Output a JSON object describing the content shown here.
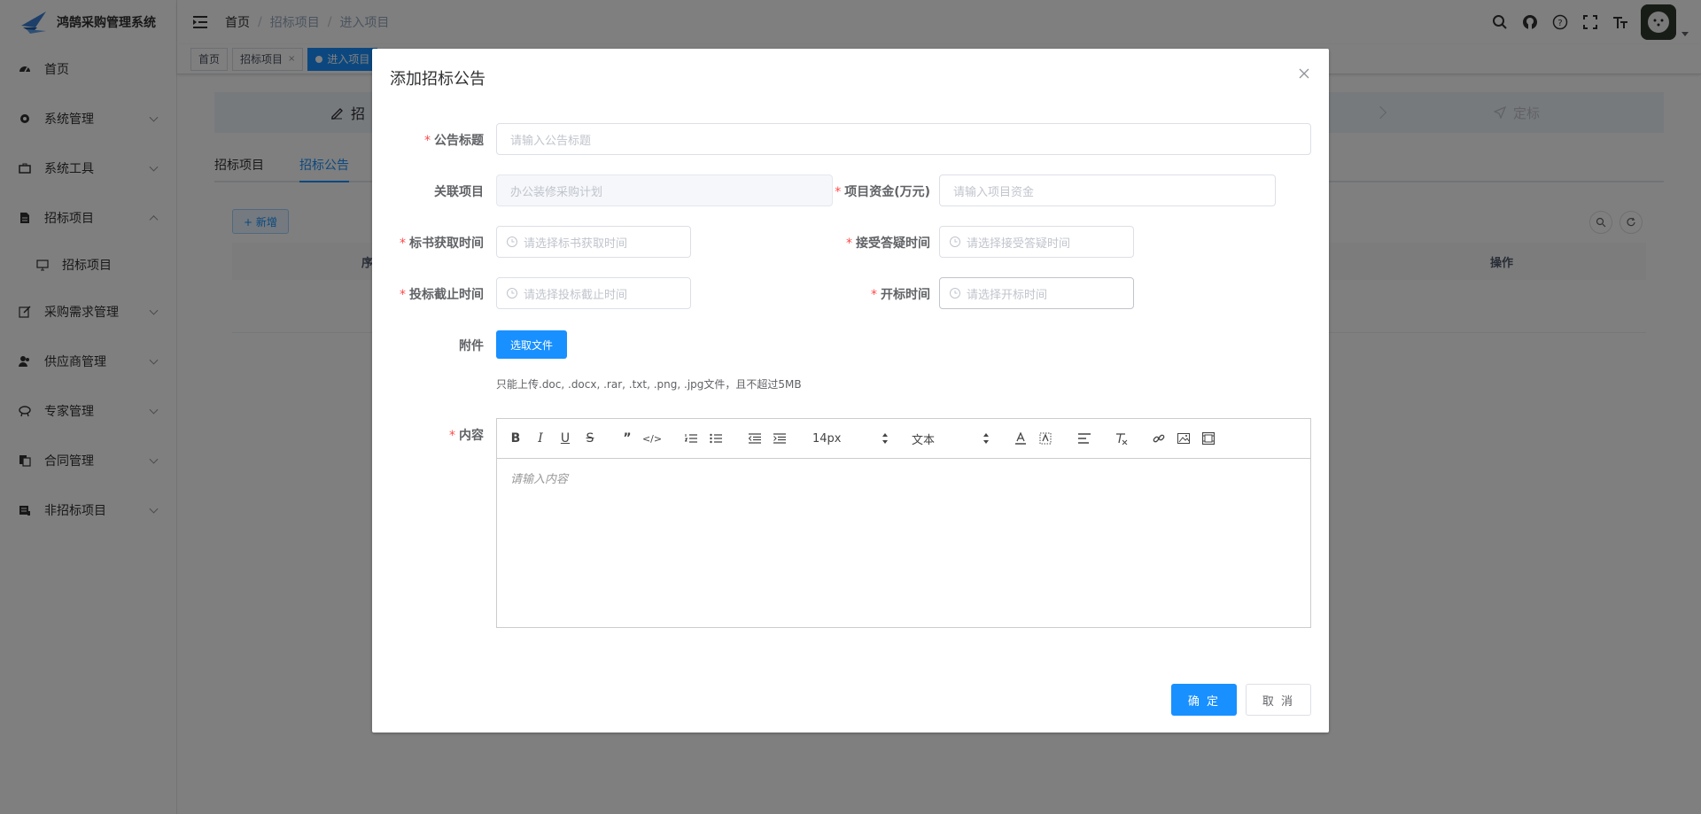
{
  "app": {
    "title": "鸿鹄采购管理系统"
  },
  "sidebar": {
    "items": [
      {
        "label": "首页",
        "icon": "dashboard-icon"
      },
      {
        "label": "系统管理",
        "icon": "gear-icon"
      },
      {
        "label": "系统工具",
        "icon": "toolbox-icon"
      },
      {
        "label": "招标项目",
        "icon": "document-icon",
        "expanded": true
      },
      {
        "label": "招标项目",
        "icon": "monitor-icon",
        "sub": true
      },
      {
        "label": "采购需求管理",
        "icon": "edit-icon"
      },
      {
        "label": "供应商管理",
        "icon": "people-icon"
      },
      {
        "label": "专家管理",
        "icon": "expert-icon"
      },
      {
        "label": "合同管理",
        "icon": "contract-icon"
      },
      {
        "label": "非招标项目",
        "icon": "list-icon"
      }
    ]
  },
  "breadcrumb": [
    "首页",
    "招标项目",
    "进入项目"
  ],
  "tags": [
    {
      "label": "首页"
    },
    {
      "label": "招标项目"
    },
    {
      "label": "进入项目",
      "active": true
    }
  ],
  "main": {
    "step_title": "招",
    "step_last": "定标",
    "tabs": [
      "招标项目",
      "招标公告"
    ],
    "new_button": "+ 新增",
    "table_headers": {
      "first": "序",
      "last": "操作"
    }
  },
  "dialog": {
    "title": "添加招标公告",
    "fields": {
      "title": {
        "label": "公告标题",
        "placeholder": "请输入公告标题"
      },
      "project": {
        "label": "关联项目",
        "value": "办公装修采购计划"
      },
      "funds": {
        "label": "项目资金(万元)",
        "placeholder": "请输入项目资金"
      },
      "doc_time": {
        "label": "标书获取时间",
        "placeholder": "请选择标书获取时间"
      },
      "qa_time": {
        "label": "接受答疑时间",
        "placeholder": "请选择接受答疑时间"
      },
      "deadline": {
        "label": "投标截止时间",
        "placeholder": "请选择投标截止时间"
      },
      "open_time": {
        "label": "开标时间",
        "placeholder": "请选择开标时间"
      },
      "attachment": {
        "label": "附件",
        "button": "选取文件",
        "tip": "只能上传.doc, .docx, .rar, .txt, .png, .jpg文件，且不超过5MB"
      },
      "content": {
        "label": "内容",
        "placeholder": "请输入内容"
      }
    },
    "editor": {
      "font_size": "14px",
      "format": "文本"
    },
    "confirm": "确 定",
    "cancel": "取 消"
  },
  "colors": {
    "primary": "#1890ff",
    "required": "#ff4949"
  }
}
